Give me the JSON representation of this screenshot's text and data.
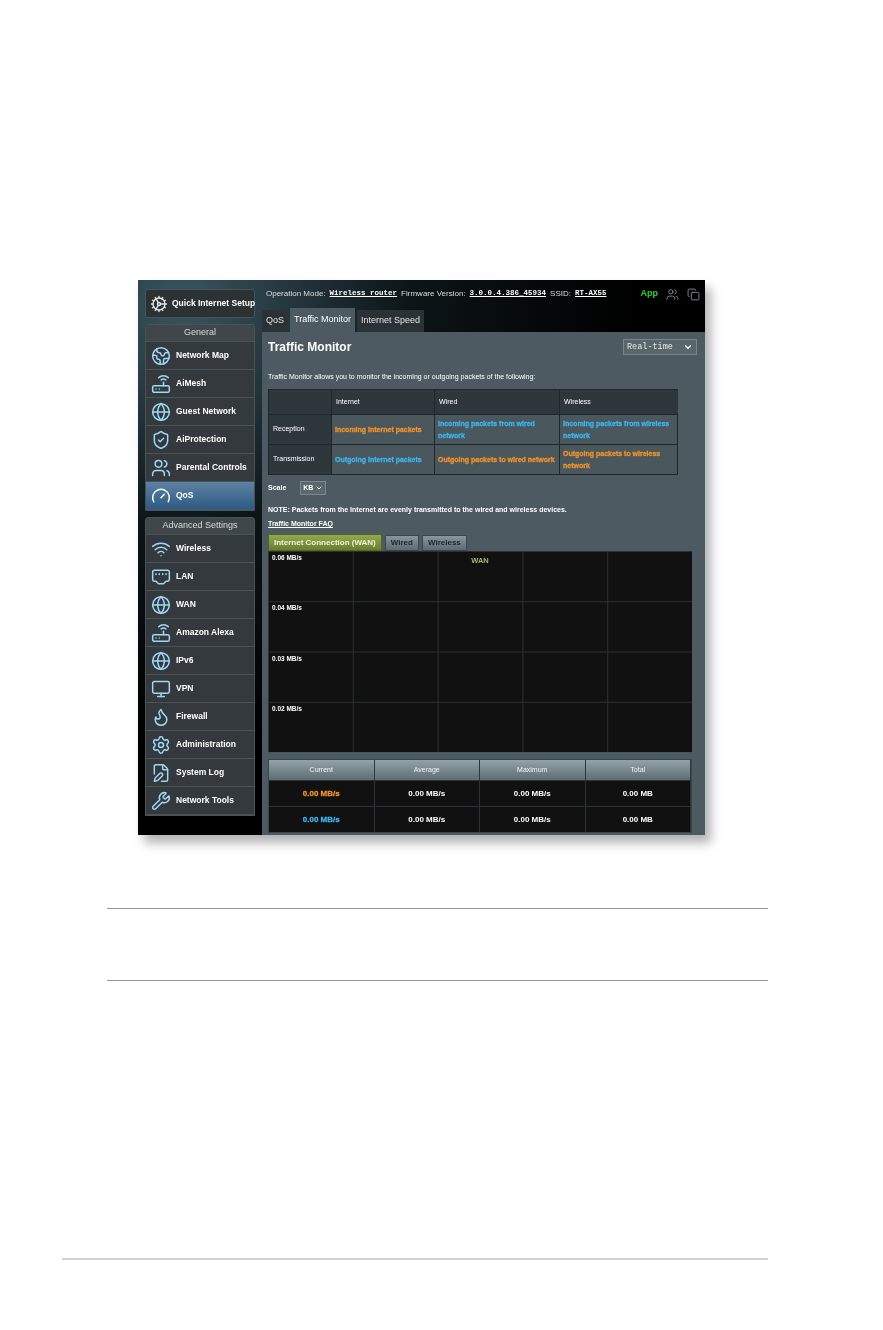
{
  "header": {
    "fields": [
      {
        "label": "Operation Mode:",
        "value": "Wireless router"
      },
      {
        "label": "Firmware Version:",
        "value": "3.0.0.4.386_45934"
      },
      {
        "label": "SSID:",
        "value": "RT-AX55"
      }
    ],
    "app_link": "App"
  },
  "sidebar": {
    "quick_setup": "Quick Internet Setup",
    "sections": [
      {
        "title": "General",
        "items": [
          {
            "label": "Network Map",
            "selected": false
          },
          {
            "label": "AiMesh",
            "selected": false
          },
          {
            "label": "Guest Network",
            "selected": false
          },
          {
            "label": "AiProtection",
            "selected": false
          },
          {
            "label": "Parental Controls",
            "selected": false
          },
          {
            "label": "QoS",
            "selected": true
          }
        ]
      },
      {
        "title": "Advanced Settings",
        "items": [
          {
            "label": "Wireless",
            "selected": false
          },
          {
            "label": "LAN",
            "selected": false
          },
          {
            "label": "WAN",
            "selected": false
          },
          {
            "label": "Amazon Alexa",
            "selected": false
          },
          {
            "label": "IPv6",
            "selected": false
          },
          {
            "label": "VPN",
            "selected": false
          },
          {
            "label": "Firewall",
            "selected": false
          },
          {
            "label": "Administration",
            "selected": false
          },
          {
            "label": "System Log",
            "selected": false
          },
          {
            "label": "Network Tools",
            "selected": false
          }
        ]
      }
    ]
  },
  "tabs": [
    {
      "label": "QoS",
      "selected": false
    },
    {
      "label": "Traffic Monitor",
      "selected": true
    },
    {
      "label": "Internet Speed",
      "selected": false
    }
  ],
  "panel": {
    "title": "Traffic Monitor",
    "period_select": "Real-time",
    "description": "Traffic Monitor allows you to monitor the incoming or outgoing packets of the following:",
    "packet_table": {
      "columns": [
        "Internet",
        "Wired",
        "Wireless"
      ],
      "rows": [
        {
          "label": "Reception",
          "cells": [
            {
              "text": "Incoming Internet packets",
              "color": "#f0922b"
            },
            {
              "text": "Incoming packets from wired network",
              "color": "#3db4ef"
            },
            {
              "text": "Incoming packets from wireless network",
              "color": "#3db4ef"
            }
          ]
        },
        {
          "label": "Transmission",
          "cells": [
            {
              "text": "Outgoing Internet packets",
              "color": "#3db4ef"
            },
            {
              "text": "Outgoing packets to wired network",
              "color": "#f0922b"
            },
            {
              "text": "Outgoing packets to wireless network",
              "color": "#f0922b"
            }
          ]
        }
      ]
    },
    "scale": {
      "label": "Scale",
      "value": "KB"
    },
    "note": "NOTE: Packets from the Internet are evenly transmitted to the wired and wireless devices.",
    "faq_link": "Traffic Monitor FAQ",
    "graph_tabs": [
      {
        "label": "Internet Connection (WAN)",
        "selected": true
      },
      {
        "label": "Wired",
        "selected": false
      },
      {
        "label": "Wireless",
        "selected": false
      }
    ],
    "graph": {
      "title": "WAN",
      "axis_labels": [
        "0.06 MB/s",
        "0.04 MB/s",
        "0.03 MB/s",
        "0.02 MB/s"
      ]
    },
    "stats_table": {
      "columns": [
        "Current",
        "Average",
        "Maximum",
        "Total"
      ],
      "rows": [
        {
          "color": "#f0922b",
          "cells": [
            "0.00 MB/s",
            "0.00 MB/s",
            "0.00 MB/s",
            "0.00 MB"
          ]
        },
        {
          "color": "#3db4ef",
          "cells": [
            "0.00 MB/s",
            "0.00 MB/s",
            "0.00 MB/s",
            "0.00 MB"
          ]
        }
      ]
    }
  }
}
